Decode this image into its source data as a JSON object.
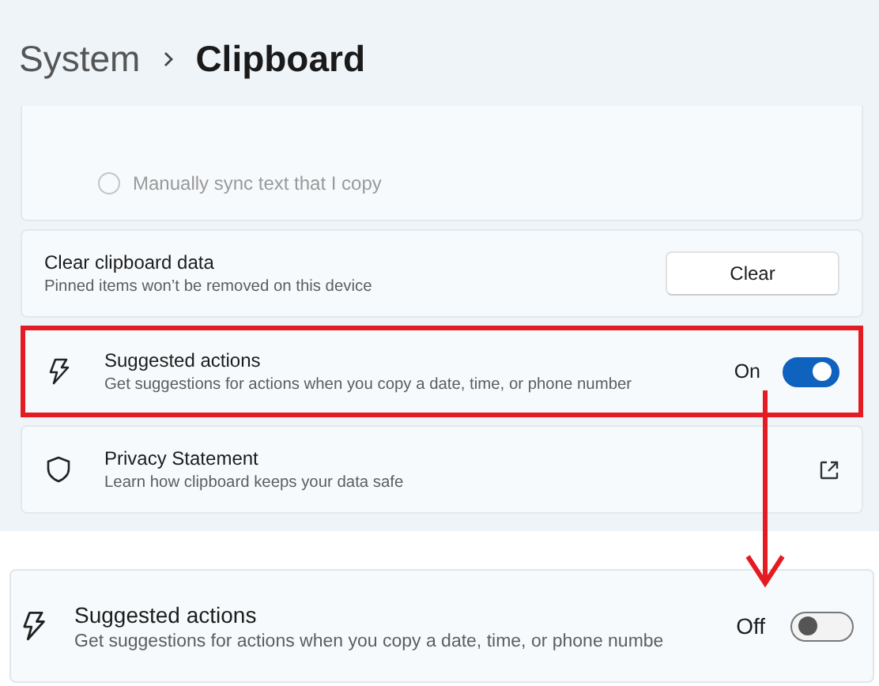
{
  "breadcrumb": {
    "parent": "System",
    "current": "Clipboard"
  },
  "sync_options": [
    {
      "label": "Manually sync text that I copy",
      "selected": false,
      "disabled": true
    }
  ],
  "settings": [
    {
      "kind": "button",
      "title": "Clear clipboard data",
      "subtitle": "Pinned items won’t be removed on this device",
      "button": "Clear",
      "highlighted": false
    },
    {
      "kind": "toggle",
      "title": "Suggested actions",
      "subtitle": "Get suggestions for actions when you copy a date, time, or phone number",
      "state_label": "On",
      "on": true,
      "highlighted": true
    },
    {
      "kind": "link",
      "title": "Privacy Statement",
      "subtitle": "Learn how clipboard keeps your data safe",
      "highlighted": false
    }
  ],
  "after": {
    "title": "Suggested actions",
    "subtitle": "Get suggestions for actions when you copy a date, time, or phone numbe",
    "state_label": "Off",
    "on": false
  }
}
